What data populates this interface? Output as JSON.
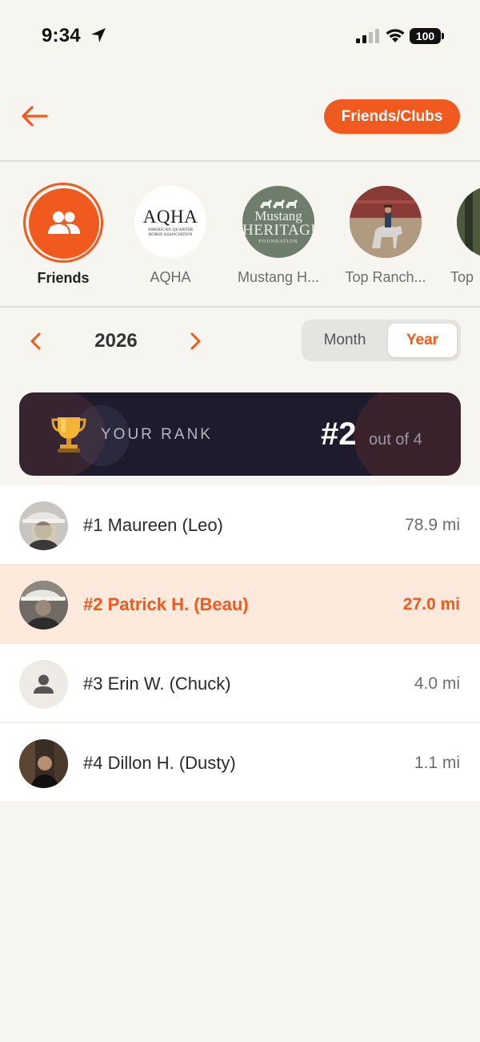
{
  "status_bar": {
    "time": "9:34",
    "battery": "100"
  },
  "header": {
    "friends_clubs_button": "Friends/Clubs"
  },
  "clubs": [
    {
      "label": "Friends",
      "active": true
    },
    {
      "label": "AQHA"
    },
    {
      "label": "Mustang H..."
    },
    {
      "label": "Top Ranch..."
    },
    {
      "label": "Top"
    }
  ],
  "aqha_logo": {
    "title": "AQHA",
    "subtitle_line1": "AMERICAN QUARTER",
    "subtitle_line2": "HORSE ASSOCIATION"
  },
  "mustang_logo": {
    "line1": "Mustang",
    "line2": "HERITAGE",
    "line3": "FOUNDATION"
  },
  "period": {
    "year": "2026",
    "month_label": "Month",
    "year_label": "Year",
    "selected": "Year"
  },
  "rank_card": {
    "label": "YOUR RANK",
    "rank": "#2",
    "out_of": "out of 4"
  },
  "leaderboard": [
    {
      "name": "#1 Maureen (Leo)",
      "distance": "78.9 mi"
    },
    {
      "name": "#2 Patrick H. (Beau)",
      "distance": "27.0 mi",
      "is_me": true
    },
    {
      "name": "#3 Erin W. (Chuck)",
      "distance": "4.0 mi"
    },
    {
      "name": "#4 Dillon H. (Dusty)",
      "distance": "1.1 mi"
    }
  ],
  "colors": {
    "accent": "#f05a1e",
    "rank_card_bg": "#1e1c2c",
    "highlight_row": "#fdeadd",
    "background": "#f7f5f0"
  }
}
